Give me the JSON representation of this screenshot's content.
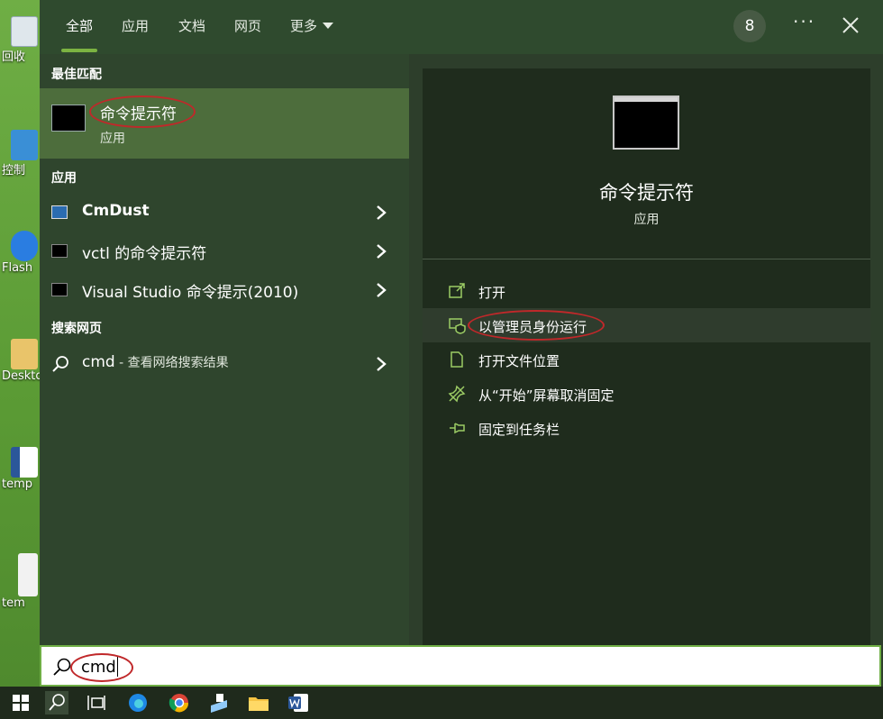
{
  "desktop": {
    "icons": [
      {
        "label": "回收"
      },
      {
        "label": "控制"
      },
      {
        "label": "Flash"
      },
      {
        "label": "Deskto"
      },
      {
        "label": "temp"
      },
      {
        "label": "tem"
      }
    ]
  },
  "tabs": [
    {
      "label": "全部"
    },
    {
      "label": "应用"
    },
    {
      "label": "文档"
    },
    {
      "label": "网页"
    },
    {
      "label": "更多"
    }
  ],
  "header": {
    "badge": "8",
    "more": "···"
  },
  "left": {
    "best_match_heading": "最佳匹配",
    "best_match": {
      "title": "命令提示符",
      "subtitle": "应用"
    },
    "apps_heading": "应用",
    "apps": [
      {
        "label": "CmDust"
      },
      {
        "label": "vctl 的命令提示符"
      },
      {
        "label": "Visual Studio 命令提示(2010)"
      }
    ],
    "web_heading": "搜索网页",
    "web": {
      "label": "cmd",
      "sub": " - 查看网络搜索结果"
    }
  },
  "right": {
    "title": "命令提示符",
    "subtitle": "应用",
    "actions": [
      {
        "label": "打开",
        "icon": "open-icon"
      },
      {
        "label": "以管理员身份运行",
        "icon": "shield-icon"
      },
      {
        "label": "打开文件位置",
        "icon": "file-location-icon"
      },
      {
        "label": "从“开始”屏幕取消固定",
        "icon": "unpin-icon"
      },
      {
        "label": "固定到任务栏",
        "icon": "pin-icon"
      }
    ]
  },
  "search": {
    "value": "cmd"
  },
  "colors": {
    "accent": "#7cb342",
    "highlight": "#c0282a"
  }
}
